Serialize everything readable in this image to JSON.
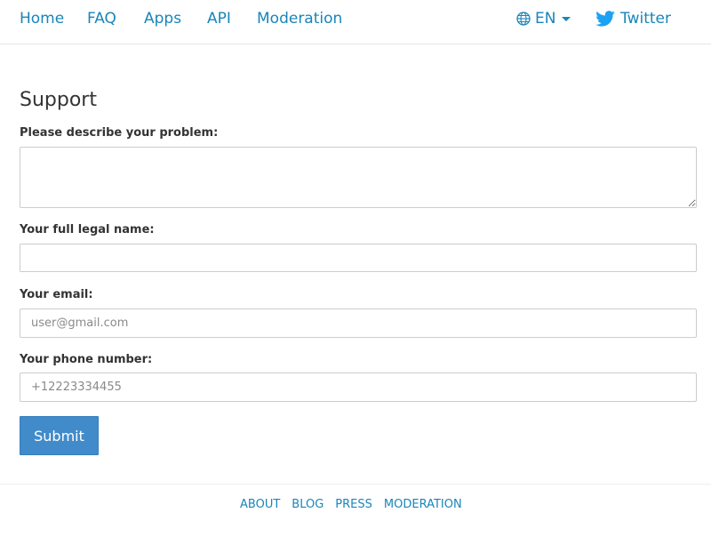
{
  "nav": {
    "items": [
      {
        "label": "Home"
      },
      {
        "label": "FAQ"
      },
      {
        "label": "Apps"
      },
      {
        "label": "API"
      },
      {
        "label": "Moderation"
      }
    ],
    "language": "EN",
    "twitter": "Twitter"
  },
  "page": {
    "title": "Support"
  },
  "form": {
    "problem_label": "Please describe your problem:",
    "problem_value": "",
    "name_label": "Your full legal name:",
    "name_value": "",
    "email_label": "Your email:",
    "email_placeholder": "user@gmail.com",
    "phone_label": "Your phone number:",
    "phone_placeholder": "+12223334455",
    "submit_label": "Submit"
  },
  "footer": {
    "links": [
      {
        "label": "ABOUT"
      },
      {
        "label": "BLOG"
      },
      {
        "label": "PRESS"
      },
      {
        "label": "MODERATION"
      }
    ]
  },
  "colors": {
    "link": "#1a85b9",
    "button": "#428bca",
    "twitter_brand": "#1da1f2"
  }
}
